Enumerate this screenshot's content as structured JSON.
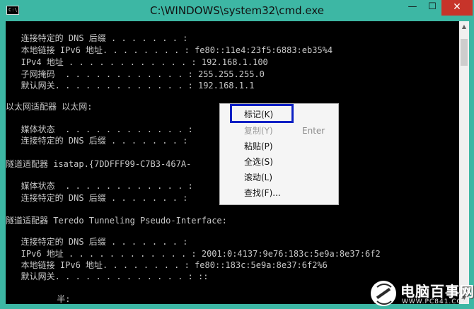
{
  "window": {
    "title": "C:\\WINDOWS\\system32\\cmd.exe",
    "icon_text": "C:\\",
    "minimize": "—",
    "maximize": "☐",
    "close": "✕"
  },
  "console": {
    "lines": [
      "   连接特定的 DNS 后缀 . . . . . . . :",
      "   本地链接 IPv6 地址. . . . . . . . : fe80::11e4:23f5:6883:eb35%4",
      "   IPv4 地址 . . . . . . . . . . . . : 192.168.1.100",
      "   子网掩码  . . . . . . . . . . . . : 255.255.255.0",
      "   默认网关. . . . . . . . . . . . . : 192.168.1.1",
      "",
      "以太网适配器 以太网:",
      "",
      "   媒体状态  . . . . . . . . . . . . :",
      "   连接特定的 DNS 后缀 . . . . . . . :",
      "",
      "隧道适配器 isatap.{7DDFFF99-C7B3-467A-",
      "",
      "   媒体状态  . . . . . . . . . . . . :",
      "   连接特定的 DNS 后缀 . . . . . . . :",
      "",
      "隧道适配器 Teredo Tunneling Pseudo-Interface:",
      "",
      "   连接特定的 DNS 后缀 . . . . . . . :",
      "   IPv6 地址 . . . . . . . . . . . . : 2001:0:4137:9e76:183c:5e9a:8e37:6f2",
      "   本地链接 IPv6 地址. . . . . . . . : fe80::183c:5e9a:8e37:6f2%6",
      "   默认网关. . . . . . . . . . . . . : ::",
      "",
      "          半:"
    ]
  },
  "scrollbar": {
    "up": "▲",
    "down": "▼"
  },
  "context_menu": {
    "items": [
      {
        "label": "标记(K)",
        "accel": ""
      },
      {
        "label": "复制(Y)",
        "accel": "Enter"
      },
      {
        "label": "粘贴(P)",
        "accel": ""
      },
      {
        "label": "全选(S)",
        "accel": ""
      },
      {
        "label": "滚动(L)",
        "accel": ""
      },
      {
        "label": "查找(F)...",
        "accel": ""
      }
    ]
  },
  "watermark": {
    "name": "电脑百事网",
    "url": "WWW.PC841.COM"
  }
}
